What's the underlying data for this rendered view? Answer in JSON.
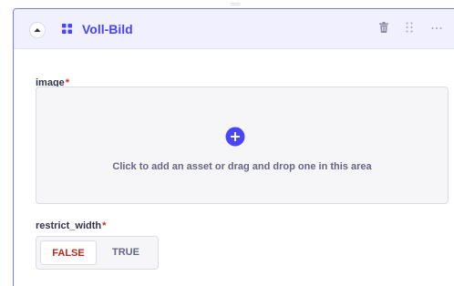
{
  "component": {
    "title": "Voll-Bild",
    "icons": {
      "collapse": "chevron-up-icon",
      "block": "grid-icon",
      "delete": "trash-icon",
      "drag": "drag-handle-icon",
      "more": "more-icon"
    }
  },
  "fields": {
    "image": {
      "label": "image",
      "required_marker": "*",
      "dropzone_text": "Click to add an asset or drag and drop one in this area",
      "dropzone_icon": "plus-circle-icon"
    },
    "restrict_width": {
      "label": "restrict_width",
      "required_marker": "*",
      "options": [
        "FALSE",
        "TRUE"
      ],
      "selected": "FALSE"
    }
  },
  "colors": {
    "accent": "#4945ff",
    "header_bg": "#f0f0ff",
    "required": "#d02b20",
    "false_selected": "#b72b1a"
  }
}
